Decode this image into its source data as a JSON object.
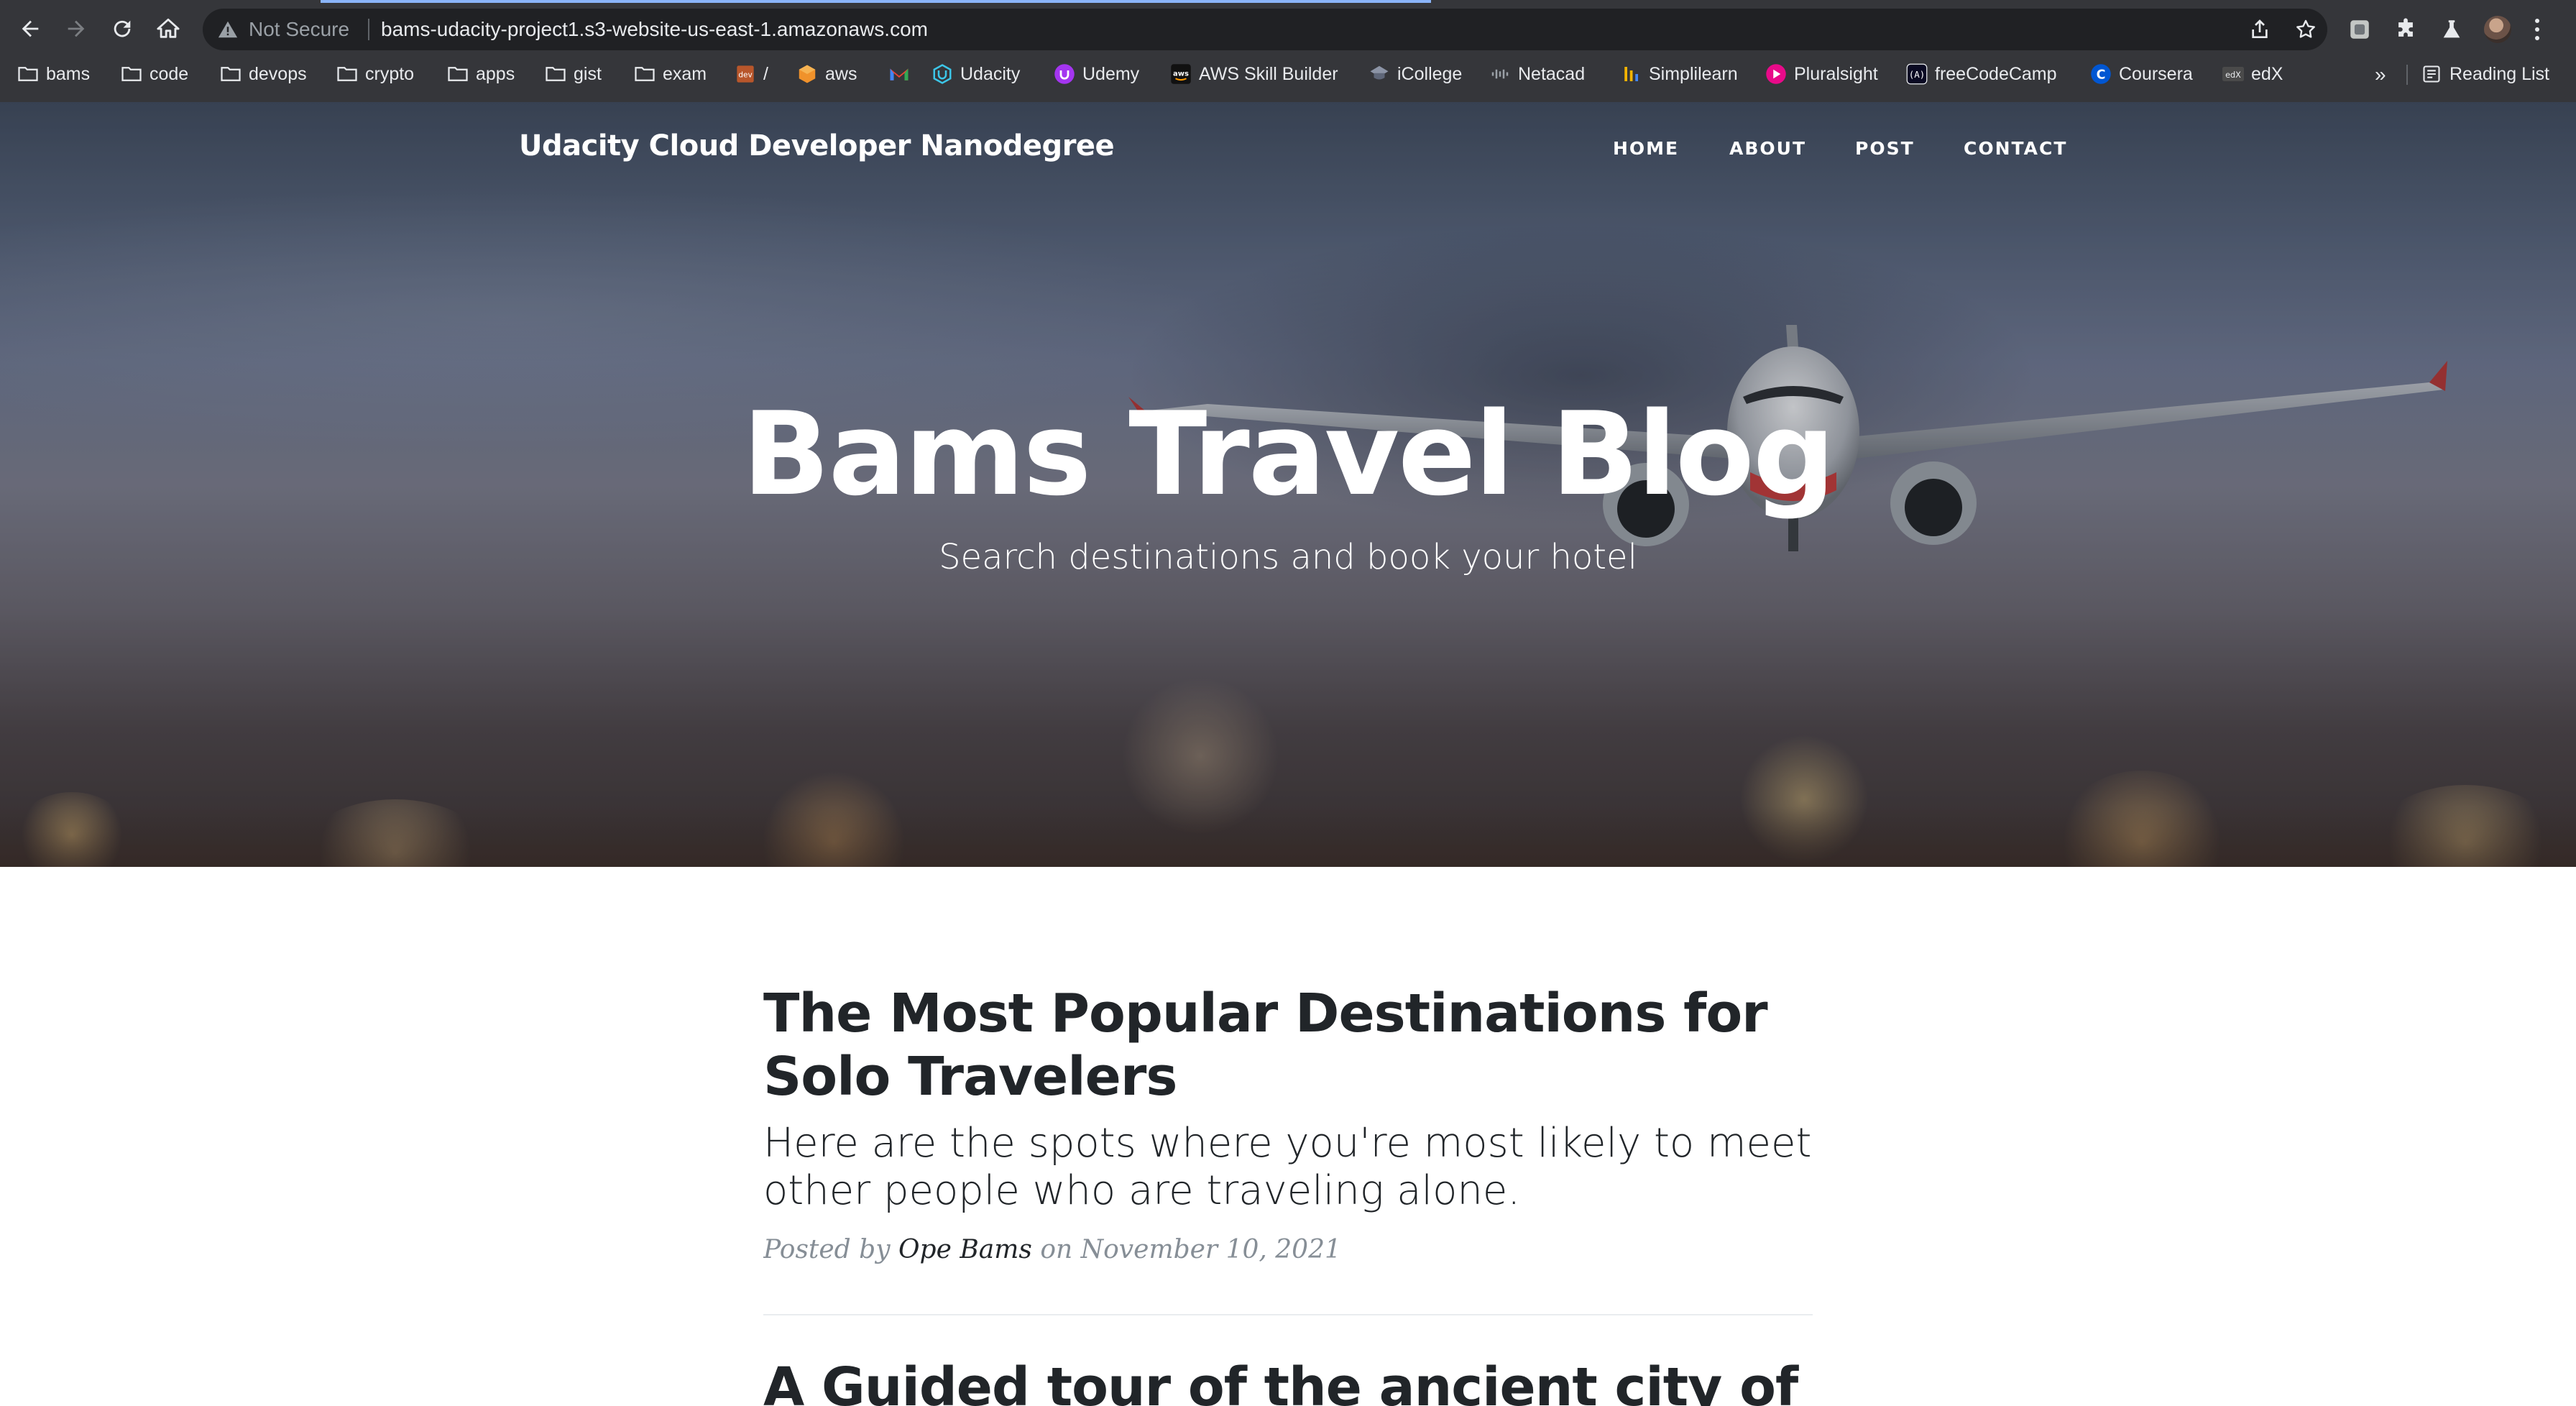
{
  "browser": {
    "security_label": "Not Secure",
    "url": "bams-udacity-project1.s3-website-us-east-1.amazonaws.com",
    "bookmarks": [
      {
        "label": "bams",
        "icon": "folder-icon"
      },
      {
        "label": "code",
        "icon": "folder-icon"
      },
      {
        "label": "devops",
        "icon": "folder-icon"
      },
      {
        "label": "crypto",
        "icon": "folder-icon"
      },
      {
        "label": "apps",
        "icon": "folder-icon"
      },
      {
        "label": "gist",
        "icon": "folder-icon"
      },
      {
        "label": "exam",
        "icon": "folder-icon"
      },
      {
        "label": "/",
        "icon": "dev-icon"
      },
      {
        "label": "aws",
        "icon": "aws-box-icon"
      },
      {
        "label": "",
        "icon": "gmail-icon"
      },
      {
        "label": "Udacity",
        "icon": "udacity-icon"
      },
      {
        "label": "Udemy",
        "icon": "udemy-icon"
      },
      {
        "label": "AWS Skill Builder",
        "icon": "aws-skill-builder-icon"
      },
      {
        "label": "iCollege",
        "icon": "icollege-icon"
      },
      {
        "label": "Netacad",
        "icon": "cisco-icon"
      },
      {
        "label": "Simplilearn",
        "icon": "simplilearn-icon"
      },
      {
        "label": "Pluralsight",
        "icon": "pluralsight-icon"
      },
      {
        "label": "freeCodeCamp",
        "icon": "freecodecamp-icon"
      },
      {
        "label": "Coursera",
        "icon": "coursera-icon"
      },
      {
        "label": "edX",
        "icon": "edx-icon"
      }
    ],
    "more_label": "»",
    "reading_list_label": "Reading List"
  },
  "site": {
    "brand": "Udacity Cloud Developer Nanodegree",
    "nav": [
      "HOME",
      "ABOUT",
      "POST",
      "CONTACT"
    ],
    "hero_title": "Bams Travel Blog",
    "hero_subtitle": "Search destinations and book your hotel"
  },
  "posts": [
    {
      "title": "The Most Popular Destinations for Solo Travelers",
      "subtitle": "Here are the spots where you're most likely to meet other people who are traveling alone.",
      "meta_prefix": "Posted by",
      "author": "Ope Bams",
      "meta_on": "on",
      "date": "November 10, 2021"
    },
    {
      "title": "A Guided tour of the ancient city of"
    }
  ],
  "colors": {
    "chrome_bg": "#35363a",
    "omnibox_bg": "#202124",
    "load_bar": "#8ab4f8",
    "text_dark": "#212529",
    "meta_gray": "#868e96"
  }
}
